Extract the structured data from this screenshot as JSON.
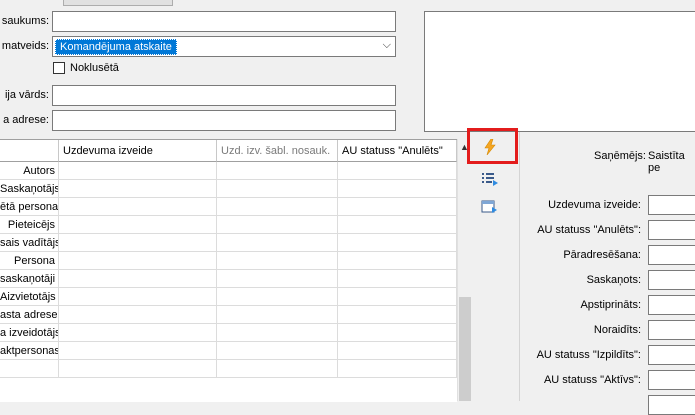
{
  "form": {
    "labels": {
      "nosaukums": "saukums:",
      "matveids": "matveids:",
      "vards": "ija vārds:",
      "adrese": "a adrese:"
    },
    "matveids_value": "Komandējuma atskaite",
    "noklusets_label": "Noklusētā"
  },
  "table": {
    "columns": [
      "Uzdevuma izveide",
      "Uzd. izv. šabl. nosauk.",
      "AU statuss \"Anulēts\""
    ],
    "rows": [
      "Autors",
      "Saskaņotājs",
      "ētā persona",
      "Pieteicējs",
      "sais vadītājs",
      "Persona",
      "saskaņotāji",
      "Aizvietotājs",
      "asta adrese",
      "a izveidotājs",
      "aktpersonas",
      ""
    ]
  },
  "toolbar": {
    "icons": [
      "lightning-icon",
      "list-arrow-icon",
      "window-arrow-icon"
    ]
  },
  "right_panel": {
    "sanemejs_label": "Saņēmējs:",
    "sanemejs_value": "Saistīta pe",
    "fields": [
      "Uzdevuma izveide:",
      "AU statuss \"Anulēts\":",
      "Pāradresēšana:",
      "Saskaņots:",
      "Apstiprināts:",
      "Noraidīts:",
      "AU statuss \"Izpildīts\":",
      "AU statuss \"Aktīvs\":"
    ]
  },
  "colors": {
    "selection": "#0078d7",
    "highlight": "#e31c1c",
    "lightning": "#f5a623"
  }
}
